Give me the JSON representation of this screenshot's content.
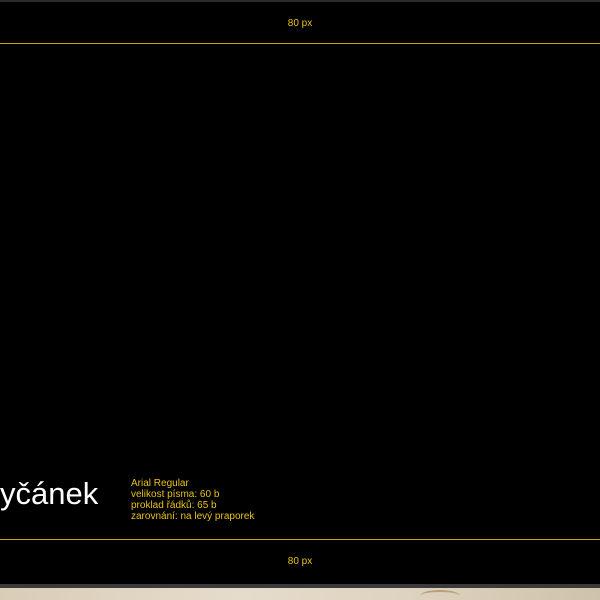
{
  "margins": {
    "top_label": "80 px",
    "bottom_label": "80 px"
  },
  "sample": {
    "text": "yčánek"
  },
  "font_spec": {
    "family": "Arial Regular",
    "size": "velikost písma: 60 b",
    "leading": "proklad řádků: 65 b",
    "alignment": "zarovnání: na levý praporek"
  },
  "colors": {
    "background": "#000000",
    "guide": "#c9a418",
    "annotation": "#e8c21a",
    "sample_text": "#ffffff"
  }
}
